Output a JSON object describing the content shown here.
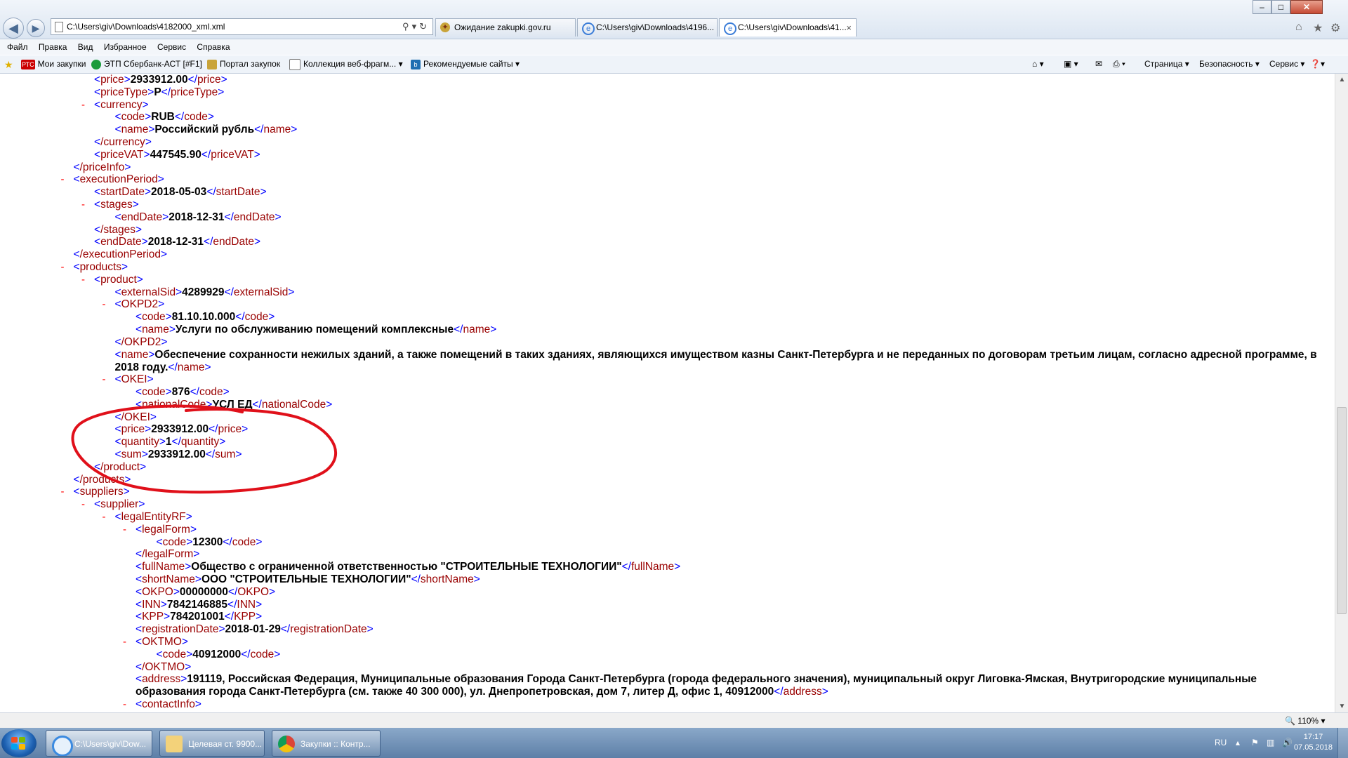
{
  "browser": {
    "address": "C:\\Users\\giv\\Downloads\\4182000_xml.xml",
    "tabs": [
      {
        "label": "Ожидание zakupki.gov.ru",
        "active": false
      },
      {
        "label": "C:\\Users\\giv\\Downloads\\4196...",
        "active": false
      },
      {
        "label": "C:\\Users\\giv\\Downloads\\41...",
        "active": true
      }
    ],
    "tab_close_glyph": "×",
    "window_buttons": {
      "minimize": "–",
      "maximize": "□",
      "close": "✕"
    }
  },
  "menu": [
    "Файл",
    "Правка",
    "Вид",
    "Избранное",
    "Сервис",
    "Справка"
  ],
  "favorites": [
    {
      "label": "Мои закупки",
      "badge": "РТС"
    },
    {
      "label": "ЭТП Сбербанк-АСТ [#F1]"
    },
    {
      "label": "Портал закупок"
    },
    {
      "label": "Коллекция веб-фрагм..."
    },
    {
      "label": "Рекомендуемые сайты"
    }
  ],
  "command_bar": [
    "Страница",
    "Безопасность",
    "Сервис"
  ],
  "xml_lines": [
    {
      "indent": 4,
      "minus": false,
      "tag": "price",
      "value": "2933912.00",
      "close": true
    },
    {
      "indent": 4,
      "minus": false,
      "tag": "priceType",
      "value": "P",
      "close": true
    },
    {
      "indent": 4,
      "minus": true,
      "tag": "currency",
      "value": "",
      "close": false
    },
    {
      "indent": 5,
      "minus": false,
      "tag": "code",
      "value": "RUB",
      "close": true
    },
    {
      "indent": 5,
      "minus": false,
      "tag": "name",
      "value": "Российский рубль",
      "close": true
    },
    {
      "indent": 4,
      "minus": false,
      "tag": "/currency",
      "value": "",
      "close": false
    },
    {
      "indent": 4,
      "minus": false,
      "tag": "priceVAT",
      "value": "447545.90",
      "close": true
    },
    {
      "indent": 3,
      "minus": false,
      "tag": "/priceInfo",
      "value": "",
      "close": false
    },
    {
      "indent": 3,
      "minus": true,
      "tag": "executionPeriod",
      "value": "",
      "close": false
    },
    {
      "indent": 4,
      "minus": false,
      "tag": "startDate",
      "value": "2018-05-03",
      "close": true
    },
    {
      "indent": 4,
      "minus": true,
      "tag": "stages",
      "value": "",
      "close": false
    },
    {
      "indent": 5,
      "minus": false,
      "tag": "endDate",
      "value": "2018-12-31",
      "close": true
    },
    {
      "indent": 4,
      "minus": false,
      "tag": "/stages",
      "value": "",
      "close": false
    },
    {
      "indent": 4,
      "minus": false,
      "tag": "endDate",
      "value": "2018-12-31",
      "close": true
    },
    {
      "indent": 3,
      "minus": false,
      "tag": "/executionPeriod",
      "value": "",
      "close": false
    },
    {
      "indent": 3,
      "minus": true,
      "tag": "products",
      "value": "",
      "close": false
    },
    {
      "indent": 4,
      "minus": true,
      "tag": "product",
      "value": "",
      "close": false
    },
    {
      "indent": 5,
      "minus": false,
      "tag": "externalSid",
      "value": "4289929",
      "close": true
    },
    {
      "indent": 5,
      "minus": true,
      "tag": "OKPD2",
      "value": "",
      "close": false
    },
    {
      "indent": 6,
      "minus": false,
      "tag": "code",
      "value": "81.10.10.000",
      "close": true
    },
    {
      "indent": 6,
      "minus": false,
      "tag": "name",
      "value": "Услуги по обслуживанию помещений комплексные",
      "close": true
    },
    {
      "indent": 5,
      "minus": false,
      "tag": "/OKPD2",
      "value": "",
      "close": false
    },
    {
      "indent": 5,
      "minus": false,
      "tag": "name",
      "value": "Обеспечение сохранности нежилых зданий, а также помещений в таких зданиях, являющихся имуществом казны Санкт-Петербурга и не переданных по договорам третьим лицам, согласно адресной программе, в 2018 году.",
      "close": true,
      "lines": 2
    },
    {
      "indent": 5,
      "minus": true,
      "tag": "OKEI",
      "value": "",
      "close": false
    },
    {
      "indent": 6,
      "minus": false,
      "tag": "code",
      "value": "876",
      "close": true
    },
    {
      "indent": 6,
      "minus": false,
      "tag": "nationalCode",
      "value": "УСЛ ЕД",
      "close": true
    },
    {
      "indent": 5,
      "minus": false,
      "tag": "/OKEI",
      "value": "",
      "close": false
    },
    {
      "indent": 5,
      "minus": false,
      "tag": "price",
      "value": "2933912.00",
      "close": true
    },
    {
      "indent": 5,
      "minus": false,
      "tag": "quantity",
      "value": "1",
      "close": true
    },
    {
      "indent": 5,
      "minus": false,
      "tag": "sum",
      "value": "2933912.00",
      "close": true
    },
    {
      "indent": 4,
      "minus": false,
      "tag": "/product",
      "value": "",
      "close": false
    },
    {
      "indent": 3,
      "minus": false,
      "tag": "/products",
      "value": "",
      "close": false
    },
    {
      "indent": 3,
      "minus": true,
      "tag": "suppliers",
      "value": "",
      "close": false
    },
    {
      "indent": 4,
      "minus": true,
      "tag": "supplier",
      "value": "",
      "close": false
    },
    {
      "indent": 5,
      "minus": true,
      "tag": "legalEntityRF",
      "value": "",
      "close": false
    },
    {
      "indent": 6,
      "minus": true,
      "tag": "legalForm",
      "value": "",
      "close": false
    },
    {
      "indent": 7,
      "minus": false,
      "tag": "code",
      "value": "12300",
      "close": true
    },
    {
      "indent": 6,
      "minus": false,
      "tag": "/legalForm",
      "value": "",
      "close": false
    },
    {
      "indent": 6,
      "minus": false,
      "tag": "fullName",
      "value": "Общество с ограниченной ответственностью \"СТРОИТЕЛЬНЫЕ ТЕХНОЛОГИИ\"",
      "close": true
    },
    {
      "indent": 6,
      "minus": false,
      "tag": "shortName",
      "value": "ООО \"СТРОИТЕЛЬНЫЕ ТЕХНОЛОГИИ\"",
      "close": true
    },
    {
      "indent": 6,
      "minus": false,
      "tag": "OKPO",
      "value": "00000000",
      "close": true
    },
    {
      "indent": 6,
      "minus": false,
      "tag": "INN",
      "value": "7842146885",
      "close": true
    },
    {
      "indent": 6,
      "minus": false,
      "tag": "KPP",
      "value": "784201001",
      "close": true
    },
    {
      "indent": 6,
      "minus": false,
      "tag": "registrationDate",
      "value": "2018-01-29",
      "close": true
    },
    {
      "indent": 6,
      "minus": true,
      "tag": "OKTMO",
      "value": "",
      "close": false
    },
    {
      "indent": 7,
      "minus": false,
      "tag": "code",
      "value": "40912000",
      "close": true
    },
    {
      "indent": 6,
      "minus": false,
      "tag": "/OKTMO",
      "value": "",
      "close": false
    },
    {
      "indent": 6,
      "minus": false,
      "tag": "address",
      "value": "191119, Российская Федерация, Муниципальные образования Города Санкт-Петербурга (города федерального значения), муниципальный округ Лиговка-Ямская, Внутригородские муниципальные образования города Санкт-Петербурга (см. также 40 300 000), ул. Днепропетровская, дом 7, литер Д, офис 1, 40912000",
      "close": true,
      "lines": 2
    },
    {
      "indent": 6,
      "minus": true,
      "tag": "contactInfo",
      "value": "",
      "close": false
    }
  ],
  "status": {
    "zoom": "110%"
  },
  "taskbar": {
    "tasks": [
      {
        "label": "C:\\Users\\giv\\Dow...",
        "active": true
      },
      {
        "label": "Целевая ст. 9900...",
        "active": false
      },
      {
        "label": "Закупки :: Контр...",
        "active": false
      }
    ],
    "lang": "RU",
    "time": "17:17",
    "date": "07.05.2018"
  },
  "colors": {
    "annotation": "#e0101a",
    "tag": "#990000",
    "bracket": "#0000ff",
    "minus": "#ff0000"
  }
}
